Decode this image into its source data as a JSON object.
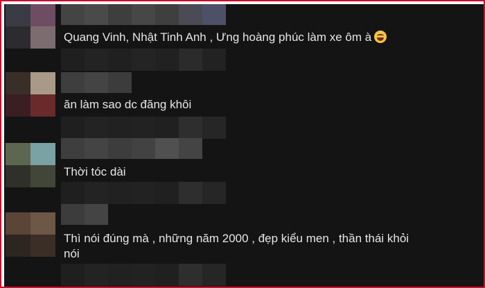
{
  "comments": [
    {
      "text": "Quang Vinh, Nhật Tinh Anh , Ưng hoàng phúc làm xe ôm à",
      "emoji": "laughing-tears-emoji"
    },
    {
      "text": "ăn làm sao dc đăng khôi"
    },
    {
      "text": "Thời tóc dài"
    },
    {
      "text": "Thì nói đúng mà , những năm 2000 , đẹp kiểu men , thần thái khỏi\nnói"
    }
  ],
  "colors": {
    "frame_border": "#c8102e",
    "background": "#141414",
    "text": "#e6e6e6"
  }
}
